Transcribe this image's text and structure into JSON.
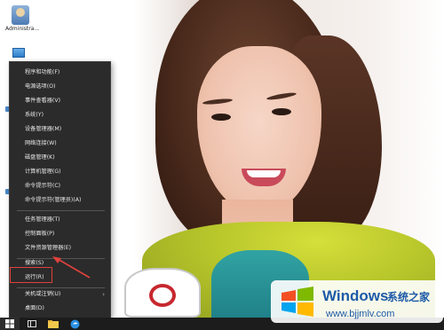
{
  "desktop": {
    "icons": [
      {
        "label": "Administra...",
        "icon": "user-folder-icon"
      },
      {
        "icon": "this-pc-icon"
      }
    ]
  },
  "context_menu": {
    "items": [
      {
        "label": "程序和功能(F)"
      },
      {
        "label": "电源选项(O)"
      },
      {
        "label": "事件查看器(V)"
      },
      {
        "label": "系统(Y)"
      },
      {
        "label": "设备管理器(M)"
      },
      {
        "label": "网络连接(W)"
      },
      {
        "label": "磁盘管理(K)"
      },
      {
        "label": "计算机管理(G)"
      },
      {
        "label": "命令提示符(C)"
      },
      {
        "label": "命令提示符(管理员)(A)"
      },
      {
        "label": "任务管理器(T)"
      },
      {
        "label": "控制面板(P)"
      },
      {
        "label": "文件资源管理器(E)"
      },
      {
        "label": "搜索(S)"
      },
      {
        "label": "运行(R)",
        "highlighted": true
      },
      {
        "label": "关机或注销(U)",
        "has_submenu": true
      },
      {
        "label": "桌面(D)"
      }
    ],
    "highlight_color": "#e0413c"
  },
  "taskbar": {
    "items": [
      "windows-start-icon",
      "task-view-icon",
      "file-explorer-icon",
      "edge-icon"
    ]
  },
  "watermark": {
    "title": "Windows",
    "subtitle": "系统之家",
    "url": "www.bjjmlv.com"
  },
  "colors": {
    "menu_bg": "#2b2b2b",
    "menu_text": "#e8e8e8",
    "taskbar_bg": "#1c1c1c",
    "accent": "#1e5aa8",
    "annotation": "#e0413c"
  }
}
